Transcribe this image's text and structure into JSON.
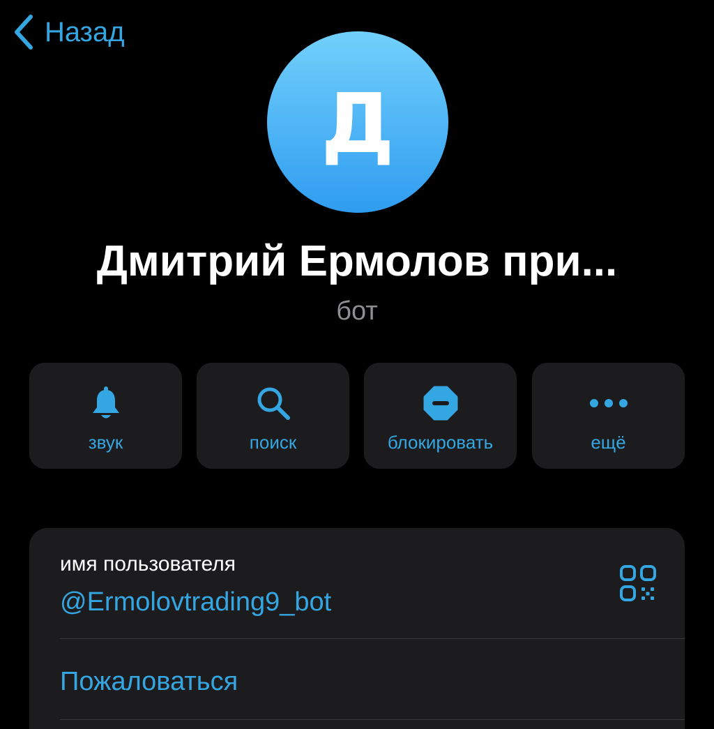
{
  "header": {
    "back_label": "Назад"
  },
  "profile": {
    "avatar_letter": "Д",
    "name": "Дмитрий Ермолов при...",
    "subtitle": "бот"
  },
  "actions": [
    {
      "label": "звук",
      "icon": "bell-icon"
    },
    {
      "label": "поиск",
      "icon": "search-icon"
    },
    {
      "label": "блокировать",
      "icon": "block-icon"
    },
    {
      "label": "ещё",
      "icon": "more-icon"
    }
  ],
  "info": {
    "username_caption": "имя пользователя",
    "username_value": "@Ermolovtrading9_bot",
    "qr_icon": "qr-code-icon",
    "report_label": "Пожаловаться"
  },
  "colors": {
    "background": "#000000",
    "card": "#1c1c1e",
    "accent": "#34a6e2",
    "secondary_text": "#8e8e93",
    "avatar_gradient_top": "#72d0fb",
    "avatar_gradient_bottom": "#2f9cf0"
  }
}
